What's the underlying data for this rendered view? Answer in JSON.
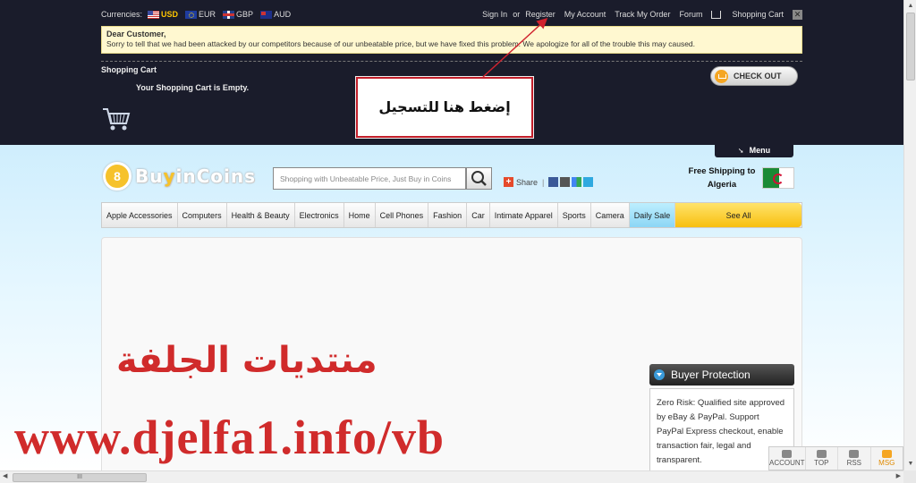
{
  "topbar": {
    "currencies_label": "Currencies:",
    "currencies": [
      {
        "code": "USD",
        "flag": "us-flag-icon",
        "active": true
      },
      {
        "code": "EUR",
        "flag": "eu-flag-icon",
        "active": false
      },
      {
        "code": "GBP",
        "flag": "gb-flag-icon",
        "active": false
      },
      {
        "code": "AUD",
        "flag": "au-flag-icon",
        "active": false
      }
    ],
    "sign_in": "Sign In",
    "or": "or",
    "register": "Register",
    "my_account": "My Account",
    "track_order": "Track My Order",
    "forum": "Forum",
    "shopping_cart": "Shopping Cart",
    "close_symbol": "✕"
  },
  "notice": {
    "greeting": "Dear Customer,",
    "message": "Sorry to tell that we had been attacked by our competitors because of our unbeatable price, but we have fixed this problem. We apologize for all of the trouble this may caused."
  },
  "cart": {
    "title": "Shopping Cart",
    "empty_message": "Your Shopping Cart is Empty.",
    "checkout_label": "CHECK OUT"
  },
  "annotation": {
    "text": "إضغط هنا للتسجيل",
    "color": "#c21e2a"
  },
  "menu_tab": {
    "label": "Menu"
  },
  "header": {
    "logo_mark": "8",
    "logo_text_1": "Bu",
    "logo_text_2": "y",
    "logo_text_3": "inCoins",
    "search_placeholder": "Shopping with Unbeatable Price, Just Buy in Coins",
    "share_label": "Share",
    "shipping_line1": "Free Shipping to",
    "shipping_line2": "Algeria"
  },
  "nav": {
    "items": [
      "Apple Accessories",
      "Computers",
      "Health & Beauty",
      "Electronics",
      "Home",
      "Cell Phones",
      "Fashion",
      "Car",
      "Intimate Apparel",
      "Sports",
      "Camera",
      "Daily Sale",
      "See All"
    ]
  },
  "buyer_protection": {
    "title": "Buyer Protection",
    "body": "Zero Risk: Qualified site approved by eBay & PayPal. Support PayPal Express checkout, enable transaction fair, legal and transparent."
  },
  "watermark": {
    "arabic": "منتديات الجلفة",
    "url": "www.djelfa1.info/vb",
    "color": "#d02b2b"
  },
  "bottom_tools": {
    "account": "ACCOUNT",
    "top": "TOP",
    "rss": "RSS",
    "msg": "MSG"
  },
  "scrollbar": {
    "thumb_grip": "III",
    "left_arrow": "◀",
    "right_arrow": "▶",
    "up_arrow": "▲",
    "down_arrow": "▼"
  }
}
